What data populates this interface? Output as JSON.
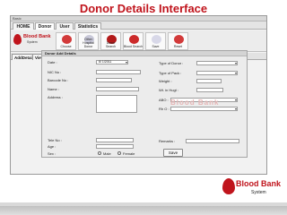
{
  "slide": {
    "title": "Donor Details Interface"
  },
  "window": {
    "title": "Basic"
  },
  "menu": {
    "items": [
      "HOME",
      "Donor",
      "User",
      "Statistics"
    ],
    "active": "Donor"
  },
  "toolbar": {
    "logo_text": "Blood Bank",
    "logo_sub": "System",
    "buttons": [
      {
        "label": "Choose",
        "color": "#d23a3a"
      },
      {
        "label": "Other Hospital Donor",
        "color": "#c8c8d8"
      },
      {
        "label": "Donor Search",
        "color": "#b31a1a"
      },
      {
        "label": "Blood Search",
        "color": "#cc2a2a"
      },
      {
        "label": "Save",
        "color": "#d8d8e8"
      },
      {
        "label": "Reset",
        "color": "#d23a3a"
      }
    ]
  },
  "subtabs": [
    "AddDetail",
    "ViewDetail"
  ],
  "form": {
    "panel_title": "Donor Add Details",
    "date_label": "Date :",
    "date_value": "6/ 1/2011",
    "nic_label": "NIC No :",
    "barcode_label": "Barcode No :",
    "name_label": "Name :",
    "address_label": "Address :",
    "tele_label": "Tele No :",
    "age_label": "Age :",
    "sex_label": "Sex :",
    "male_label": "Male",
    "female_label": "Female",
    "type_donor_label": "Type of Donor :",
    "type_pack_label": "Type of Pack :",
    "weight_label": "Weight :",
    "hb_label": "Wt. in Hugt :",
    "abo_label": "ABO :",
    "rh_label": "Rh O :",
    "remarks_label": "Remarks :",
    "save_label": "Save"
  },
  "watermark": "Blood Bank",
  "brand": {
    "name": "Blood Bank",
    "sub": "System"
  },
  "colors": {
    "accent": "#c0141c"
  }
}
